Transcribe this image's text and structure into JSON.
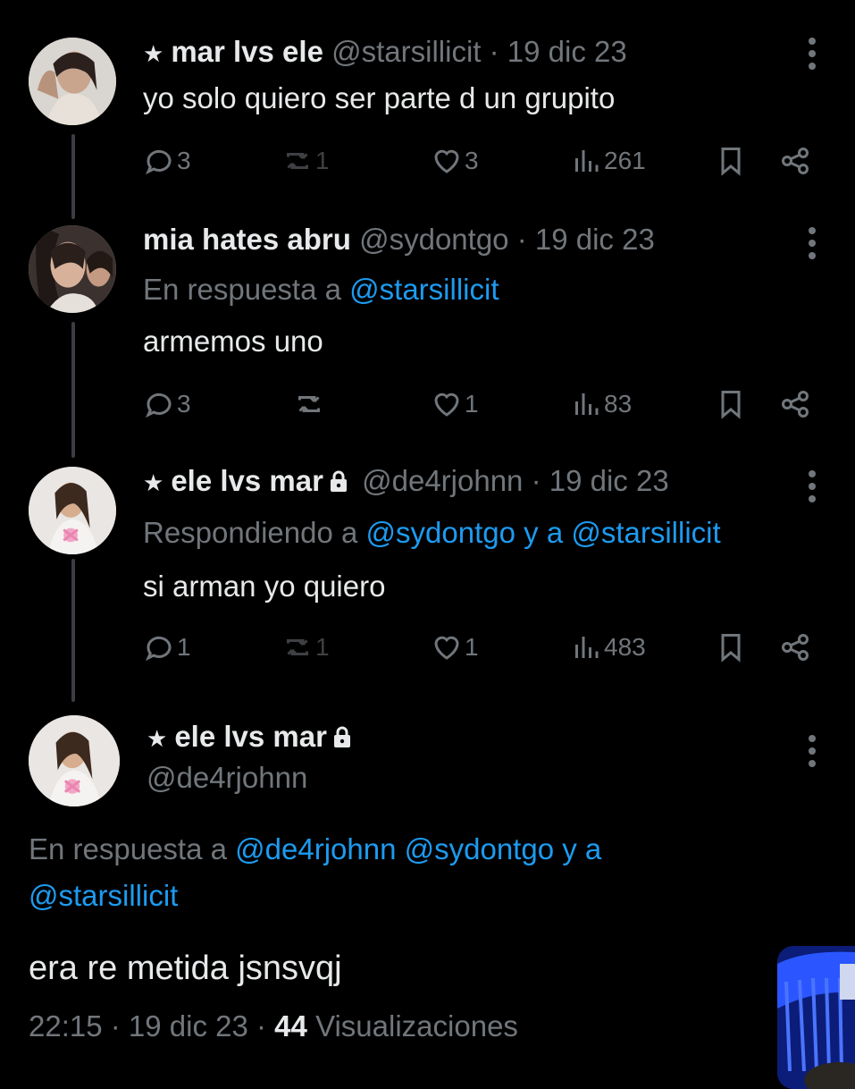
{
  "tweets": [
    {
      "name": "mar lvs ele",
      "handle": "@starsillicit",
      "date": "· 19 dic 23",
      "text": "yo solo quiero ser parte d un grupito",
      "replies": "3",
      "retweets": "1",
      "likes": "3",
      "views": "261"
    },
    {
      "name": "mia hates abru",
      "handle": "@sydontgo",
      "date": "· 19 dic 23",
      "reply_prefix": "En respuesta a",
      "reply_to": "@starsillicit",
      "text": "armemos uno",
      "replies": "3",
      "retweets": "",
      "likes": "1",
      "views": "83"
    },
    {
      "name": "ele lvs mar",
      "handle": "@de4rjohnn",
      "date": "· 19 dic 23",
      "reply_prefix": "Respondiendo a",
      "reply_to": "@sydontgo y a @starsillicit",
      "text": "si arman yo quiero",
      "replies": "1",
      "retweets": "1",
      "likes": "1",
      "views": "483"
    }
  ],
  "main": {
    "name": "ele lvs mar",
    "handle": "@de4rjohnn",
    "reply_prefix": "En respuesta a",
    "reply_to_line1": "@de4rjohnn @sydontgo y a",
    "reply_to_line2": "@starsillicit",
    "text": "era re metida jsnsvqj",
    "time": "22:15 · 19 dic 23 ·",
    "views_count": "44",
    "views_label": "Visualizaciones"
  },
  "icons": [
    "star-icon",
    "lock-icon",
    "more-icon",
    "reply-icon",
    "retweet-icon",
    "like-icon",
    "views-icon",
    "bookmark-icon",
    "share-icon"
  ],
  "colors": {
    "background": "#000000",
    "text": "#e7e9ea",
    "muted": "#71767b",
    "link": "#1d9bf0"
  }
}
